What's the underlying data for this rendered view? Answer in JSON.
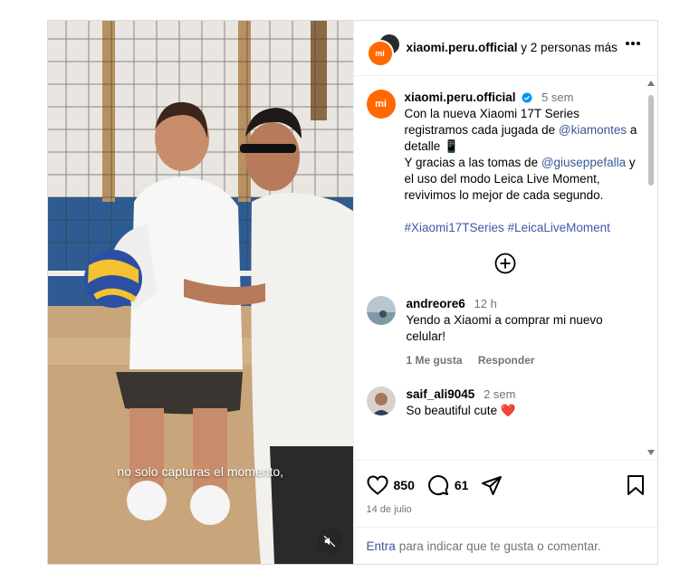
{
  "header": {
    "account": "xiaomi.peru.official",
    "suffix": "y 2 personas más"
  },
  "video": {
    "subtitle": "no solo capturas el momento,"
  },
  "caption": {
    "username": "xiaomi.peru.official",
    "time": "5 sem",
    "line1": "Con la nueva Xiaomi 17T Series registramos cada jugada de ",
    "mention1": "@kiamontes",
    "line2": " a detalle 📱",
    "line3": "Y gracias a las tomas de ",
    "mention2": "@giuseppefalla",
    "line4": " y el uso del modo Leica Live Moment, revivimos lo mejor de cada segundo.",
    "hashtags": "#Xiaomi17TSeries #LeicaLiveMoment"
  },
  "comments": [
    {
      "username": "andreore6",
      "time": "12 h",
      "text": "Yendo a Xiaomi a comprar mi nuevo celular!",
      "likes": "1 Me gusta",
      "reply": "Responder"
    },
    {
      "username": "saif_ali9045",
      "time": "2 sem",
      "text": "So beautiful cute ❤️"
    }
  ],
  "stats": {
    "likes": "850",
    "comments": "61",
    "date": "14 de julio"
  },
  "footer": {
    "login": "Entra",
    "rest": "para indicar que te gusta o comentar."
  },
  "colors": {
    "brand": "#ff6900",
    "link": "#385898",
    "muted": "#737373"
  }
}
